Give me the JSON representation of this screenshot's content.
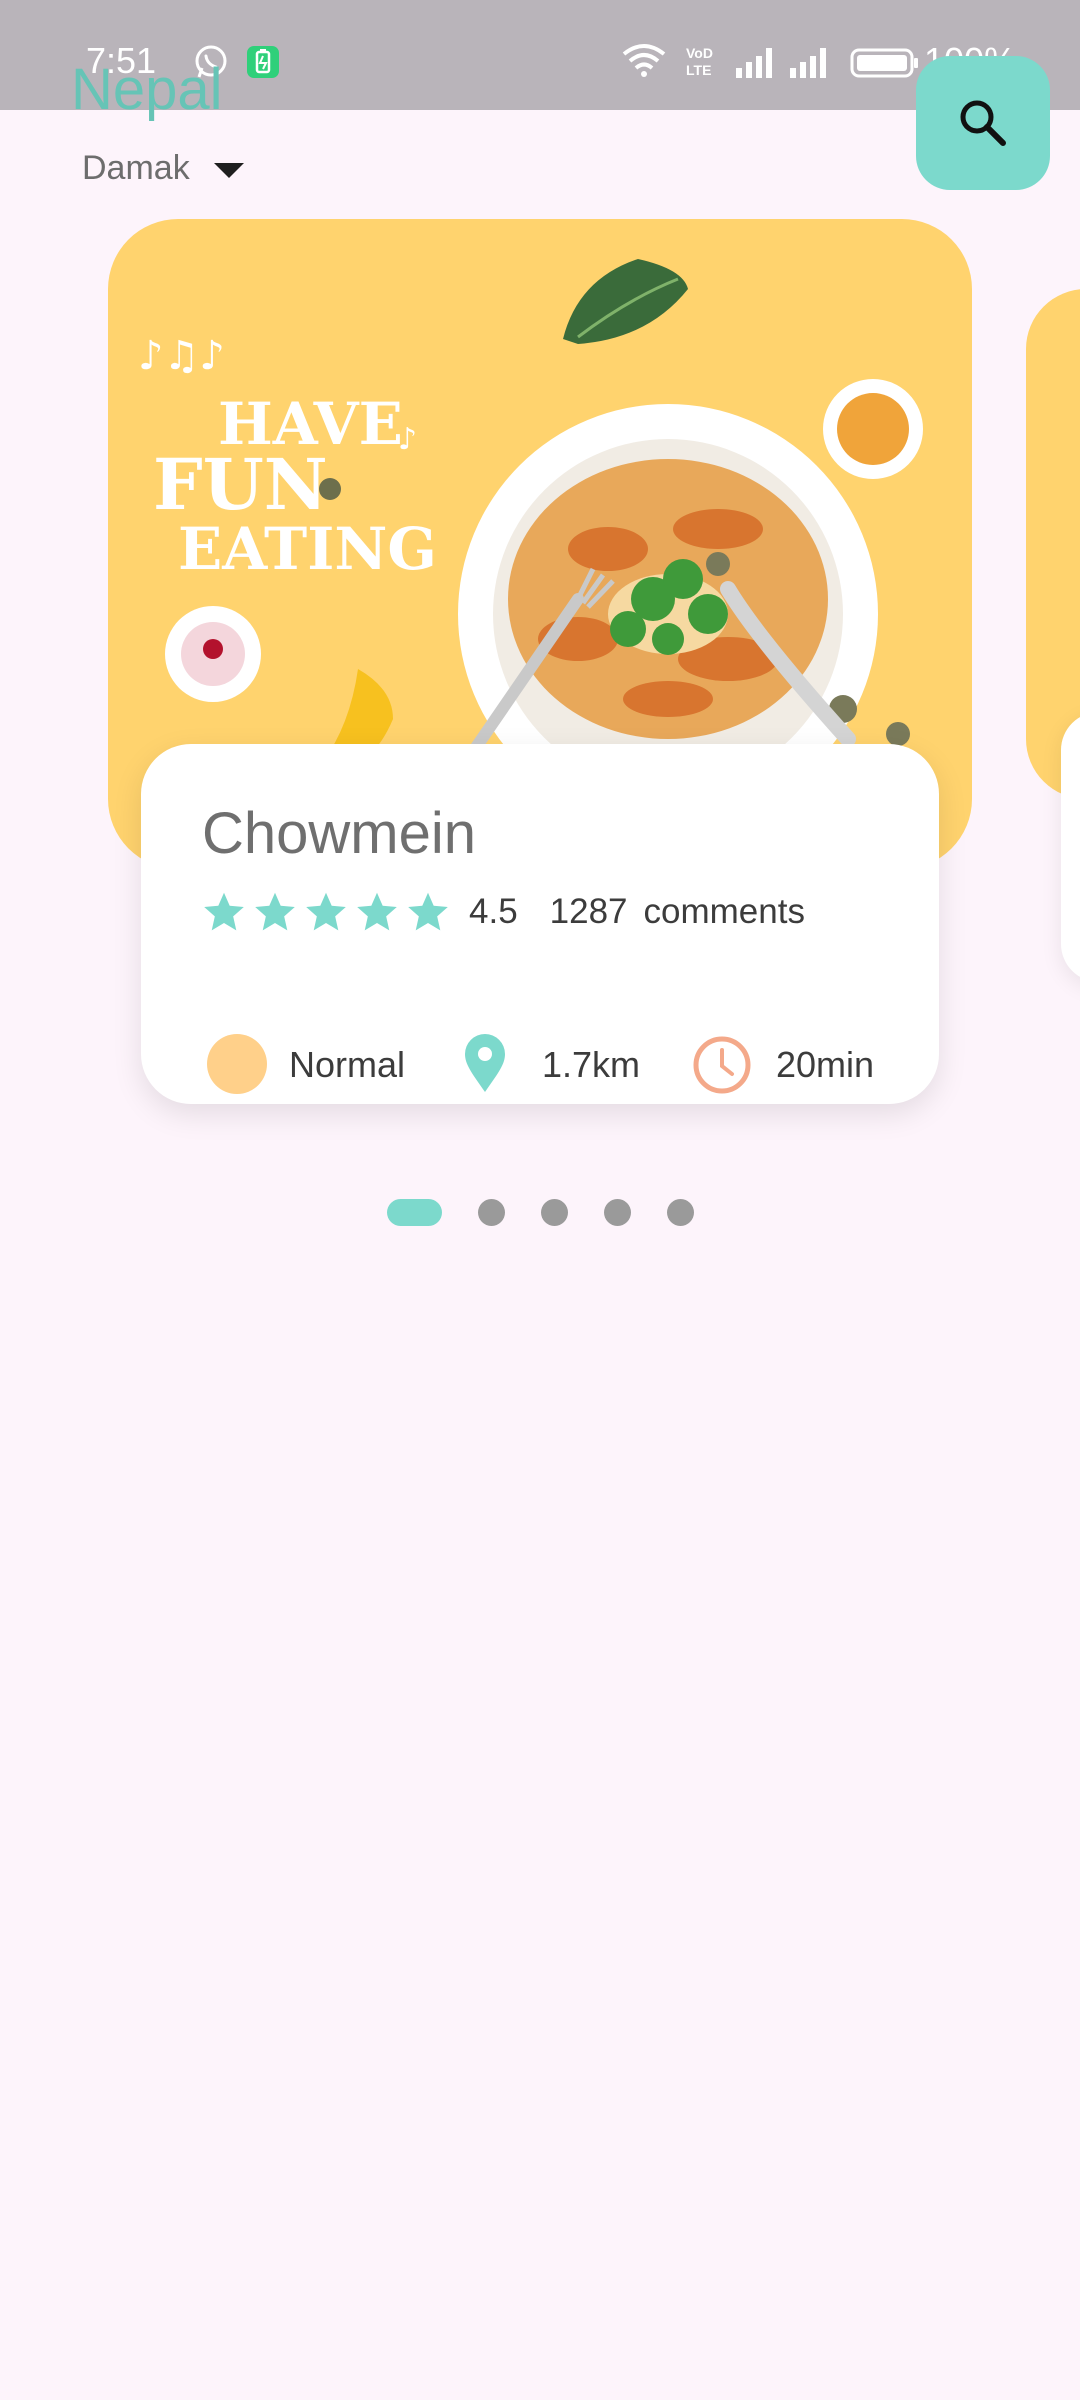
{
  "status_bar": {
    "time": "7:51",
    "battery_percent": "100%",
    "icons": [
      "whatsapp-icon",
      "battery-saver-icon",
      "wifi-icon",
      "volte-icon",
      "signal-icon",
      "signal-icon",
      "battery-icon"
    ]
  },
  "header": {
    "country": "Nepal",
    "city": "Damak",
    "search_icon": "search-icon"
  },
  "colors": {
    "accent": "#7cd9cc",
    "title": "#66c4b6",
    "card_image_bg": "#ffd36e",
    "background": "#fdf4fb",
    "level_dot": "#ffd08a",
    "clock": "#f4a98a"
  },
  "food_card": {
    "name": "Chowmein",
    "rating_stars": 5,
    "rating": "4.5",
    "comments_count": "1287",
    "comments_label": "comments",
    "level": "Normal",
    "distance": "1.7km",
    "time": "20min",
    "image_text": [
      "HAVE",
      "FUN",
      "EATING"
    ]
  },
  "pagination": {
    "total": 5,
    "active_index": 0
  }
}
